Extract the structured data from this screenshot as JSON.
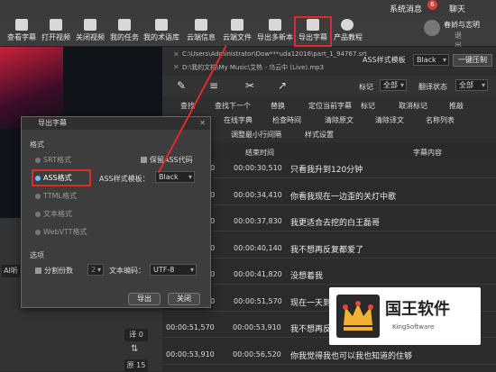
{
  "topbar": {
    "system_msg": "系统消息",
    "badge": "6",
    "chat": "聊天"
  },
  "toolbar": [
    "查看字幕",
    "打开视频",
    "关闭视频",
    "我的任务",
    "我的术语库",
    "云端信息",
    "云端文件",
    "导出多新本",
    "导出字幕",
    "产品教程"
  ],
  "user": {
    "name": "春娇与志明",
    "logout": "退出"
  },
  "files": {
    "srt": "C:\\Users\\Administrator\\Dow***uda12016\\part_1_94767.srt",
    "mp3": "D:\\我的文档\\My Music\\艾热 - 乌云中 (Live).mp3"
  },
  "ass_style": {
    "label": "ASS样式模板",
    "value": "Black",
    "onekey": "一键压制"
  },
  "tabs_right": {
    "mark_label": "标记",
    "mark_value": "全部",
    "trans_label": "翻译状态",
    "trans_value": "全部"
  },
  "tools": {
    "row1": [
      "查找",
      "查找下一个",
      "替换",
      "定位当前字幕",
      "标记",
      "取消标记",
      "推敲"
    ],
    "row2": [
      "在线字典",
      "检查時间",
      "清除原文",
      "清除译文",
      "名称列表"
    ],
    "row3": [
      "调整最小行间隔",
      "样式设置"
    ]
  },
  "table": {
    "headers": [
      "结束时间",
      "字幕内容"
    ],
    "rows": [
      {
        "start": "70",
        "end": "00:00:30,510",
        "text": "只看我升到120分钟"
      },
      {
        "start": "70",
        "end": "00:00:34,410",
        "text": "你看我现在一边歪的关灯中歌"
      },
      {
        "start": "10",
        "end": "00:00:37,830",
        "text": "我更适合去挖的白王磊哥"
      },
      {
        "start": "30",
        "end": "00:00:40,140",
        "text": "我不想再反复都爱了"
      },
      {
        "start": "40",
        "end": "00:00:41,820",
        "text": "没想着我"
      },
      {
        "start": "20",
        "end": "00:00:51,570",
        "text": "现在一天到"
      },
      {
        "start": "00:00:51,570",
        "end": "00:00:53,910",
        "text": "我不想再反"
      },
      {
        "start": "00:00:53,910",
        "end": "00:00:56,520",
        "text": "你我觉得我也可以我也知道的住够"
      }
    ]
  },
  "dialog": {
    "title": "导出字幕",
    "format_label": "格式",
    "formats": [
      "SRT格式",
      "ASS格式",
      "TTML格式",
      "文本格式",
      "WebVTT格式"
    ],
    "keep_ass": "保留ASS代码",
    "ass_template_label": "ASS样式模板：",
    "ass_template_value": "Black",
    "options_label": "选项",
    "split": "分割份数",
    "split_value": "2",
    "encoding_label": "文本编码：",
    "encoding_value": "UTF-8",
    "export": "导出",
    "close": "关闭"
  },
  "left": {
    "side_btn1": "译 0",
    "side_btn2": "原 15",
    "ai": "AI听"
  },
  "watermark": {
    "cn": "国王软件",
    "en": "KingSoftware"
  }
}
